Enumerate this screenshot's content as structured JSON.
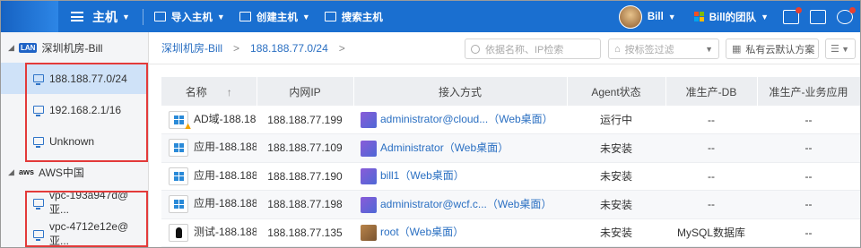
{
  "topbar": {
    "title": "主机",
    "nav": [
      {
        "label": "导入主机",
        "icon": "import-icon",
        "caret": "true"
      },
      {
        "label": "创建主机",
        "icon": "create-icon",
        "caret": "true"
      },
      {
        "label": "搜索主机",
        "icon": "search-host-icon",
        "caret": "false"
      }
    ],
    "user": "Bill",
    "team": "Bill的团队",
    "brand_color": "#1a6fd0"
  },
  "sidebar": {
    "groups": [
      {
        "label": "深圳机房-Bill",
        "badge": "LAN",
        "items": [
          "188.188.77.0/24",
          "192.168.2.1/16",
          "Unknown"
        ]
      },
      {
        "label": "AWS中国",
        "badge": "aws",
        "items": [
          "vpc-193a947d@亚...",
          "vpc-4712e12e@亚..."
        ]
      }
    ],
    "selected": "188.188.77.0/24"
  },
  "breadcrumb": {
    "items": [
      "深圳机房-Bill",
      "188.188.77.0/24"
    ],
    "separator": ">"
  },
  "filters": {
    "search_placeholder": "依据名称、IP检索",
    "tag_filter": "按标签过滤",
    "cloud_scheme": "私有云默认方案"
  },
  "table": {
    "columns": [
      "名称",
      "内网IP",
      "接入方式",
      "Agent状态",
      "准生产-DB",
      "准生产-业务应用"
    ],
    "sort_indicator": "↑",
    "rows": [
      {
        "name": "AD域-188.188...",
        "ip": "188.188.77.199",
        "access": "administrator@cloud...（Web桌面）",
        "agent": "运行中",
        "db": "--",
        "app": "--",
        "os": "windows",
        "warn": "true"
      },
      {
        "name": "应用-188.188...",
        "ip": "188.188.77.109",
        "access": "Administrator（Web桌面）",
        "agent": "未安装",
        "db": "--",
        "app": "--",
        "os": "windows",
        "warn": "false"
      },
      {
        "name": "应用-188.188...",
        "ip": "188.188.77.190",
        "access": "bill1（Web桌面）",
        "agent": "未安装",
        "db": "--",
        "app": "--",
        "os": "windows",
        "warn": "false"
      },
      {
        "name": "应用-188.188...",
        "ip": "188.188.77.198",
        "access": "administrator@wcf.c...（Web桌面）",
        "agent": "未安装",
        "db": "--",
        "app": "--",
        "os": "windows",
        "warn": "false"
      },
      {
        "name": "测试-188.188...",
        "ip": "188.188.77.135",
        "access": "root（Web桌面）",
        "agent": "未安装",
        "db": "MySQL数据库",
        "app": "--",
        "os": "linux",
        "warn": "false"
      }
    ]
  }
}
